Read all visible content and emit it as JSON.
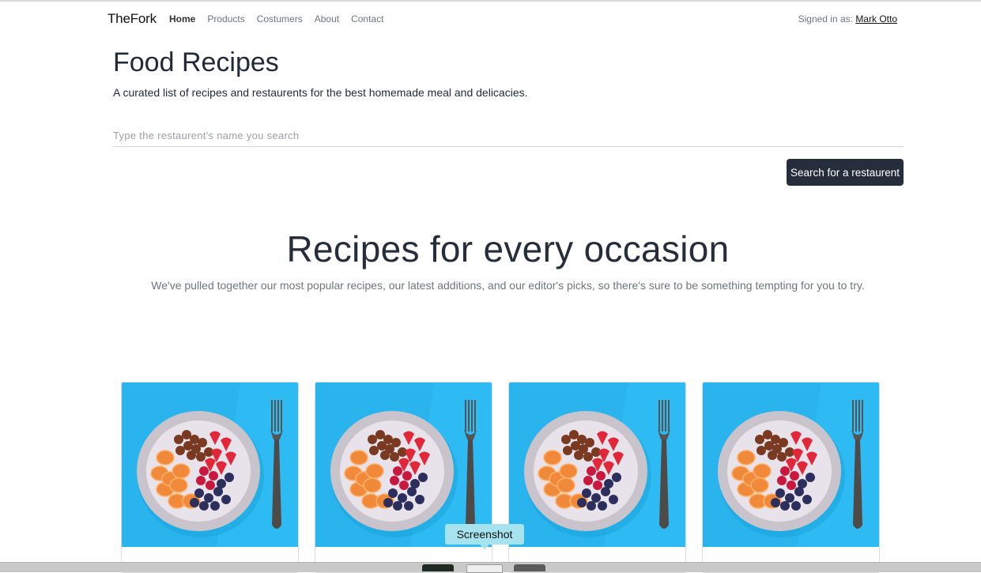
{
  "navbar": {
    "brand": "TheFork",
    "links": [
      "Home",
      "Products",
      "Costumers",
      "About",
      "Contact"
    ],
    "signed_in_label": "Signed in as: ",
    "user_name": "Mark Otto"
  },
  "hero": {
    "title": "Food Recipes",
    "subtitle": "A curated list of recipes and restaurents for the best homemade meal and delicacies."
  },
  "search": {
    "placeholder": "Type the restaurent's name you search",
    "value": "",
    "button_label": "Search for a restaurent"
  },
  "section": {
    "heading": "Recipes for every occasion",
    "lead": "We've pulled together our most popular recipes, our latest additions, and our editor's picks, so there's sure to be something tempting for you to try."
  },
  "cards": [
    {
      "image": "fruit-bowl-image"
    },
    {
      "image": "fruit-bowl-image"
    },
    {
      "image": "fruit-bowl-image"
    },
    {
      "image": "fruit-bowl-image"
    }
  ],
  "tooltip": {
    "label": "Screenshot"
  },
  "colors": {
    "button_bg": "#262d3b",
    "image_bg": "#2ab4ee",
    "tooltip_bg": "#a6e3ef"
  }
}
